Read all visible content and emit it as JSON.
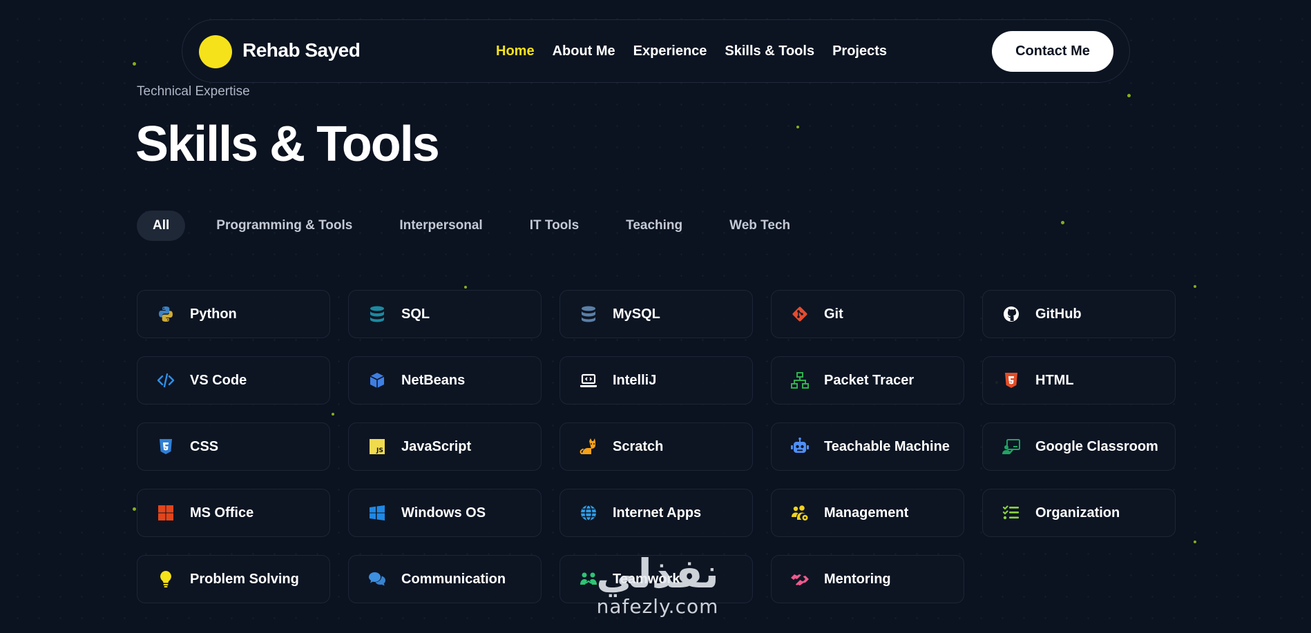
{
  "nav": {
    "brand": "Rehab Sayed",
    "links": [
      "Home",
      "About Me",
      "Experience",
      "Skills & Tools",
      "Projects"
    ],
    "active": "Home",
    "contact_label": "Contact Me"
  },
  "section": {
    "eyebrow": "Technical Expertise",
    "title": "Skills & Tools"
  },
  "filters": [
    "All",
    "Programming & Tools",
    "Interpersonal",
    "IT Tools",
    "Teaching",
    "Web Tech"
  ],
  "active_filter": "All",
  "skills": [
    {
      "label": "Python",
      "icon": "python-icon",
      "color": "#3b82c4"
    },
    {
      "label": "SQL",
      "icon": "database-icon",
      "color": "#1c8aa0"
    },
    {
      "label": "MySQL",
      "icon": "database-icon",
      "color": "#5b7fa6"
    },
    {
      "label": "Git",
      "icon": "git-icon",
      "color": "#e44c30"
    },
    {
      "label": "GitHub",
      "icon": "github-icon",
      "color": "#ffffff"
    },
    {
      "label": "VS Code",
      "icon": "code-icon",
      "color": "#2f8fe8"
    },
    {
      "label": "NetBeans",
      "icon": "cube-icon",
      "color": "#3f7fe3"
    },
    {
      "label": "IntelliJ",
      "icon": "laptop-code-icon",
      "color": "#ffffff"
    },
    {
      "label": "Packet Tracer",
      "icon": "network-icon",
      "color": "#2fb14d"
    },
    {
      "label": "HTML",
      "icon": "html5-icon",
      "color": "#e44d26"
    },
    {
      "label": "CSS",
      "icon": "css3-icon",
      "color": "#2f7fd6"
    },
    {
      "label": "JavaScript",
      "icon": "js-icon",
      "color": "#f0db4f"
    },
    {
      "label": "Scratch",
      "icon": "cat-icon",
      "color": "#f7a21b"
    },
    {
      "label": "Teachable Machine",
      "icon": "robot-icon",
      "color": "#4f8ff7"
    },
    {
      "label": "Google Classroom",
      "icon": "classroom-icon",
      "color": "#1fa463"
    },
    {
      "label": "MS Office",
      "icon": "office-icon",
      "color": "#e2451b"
    },
    {
      "label": "Windows OS",
      "icon": "windows-icon",
      "color": "#1f88e5"
    },
    {
      "label": "Internet Apps",
      "icon": "globe-icon",
      "color": "#2f9de8"
    },
    {
      "label": "Management",
      "icon": "users-cog-icon",
      "color": "#f2d21c"
    },
    {
      "label": "Organization",
      "icon": "list-check-icon",
      "color": "#8bd43a"
    },
    {
      "label": "Problem Solving",
      "icon": "lightbulb-icon",
      "color": "#f6e21a"
    },
    {
      "label": "Communication",
      "icon": "comments-icon",
      "color": "#3d8fe0"
    },
    {
      "label": "Teamwork",
      "icon": "team-icon",
      "color": "#2fc474"
    },
    {
      "label": "Mentoring",
      "icon": "handshake-icon",
      "color": "#ef5a8c"
    }
  ],
  "watermark": {
    "arabic": "نفذلي",
    "site": "nafezly.com"
  }
}
